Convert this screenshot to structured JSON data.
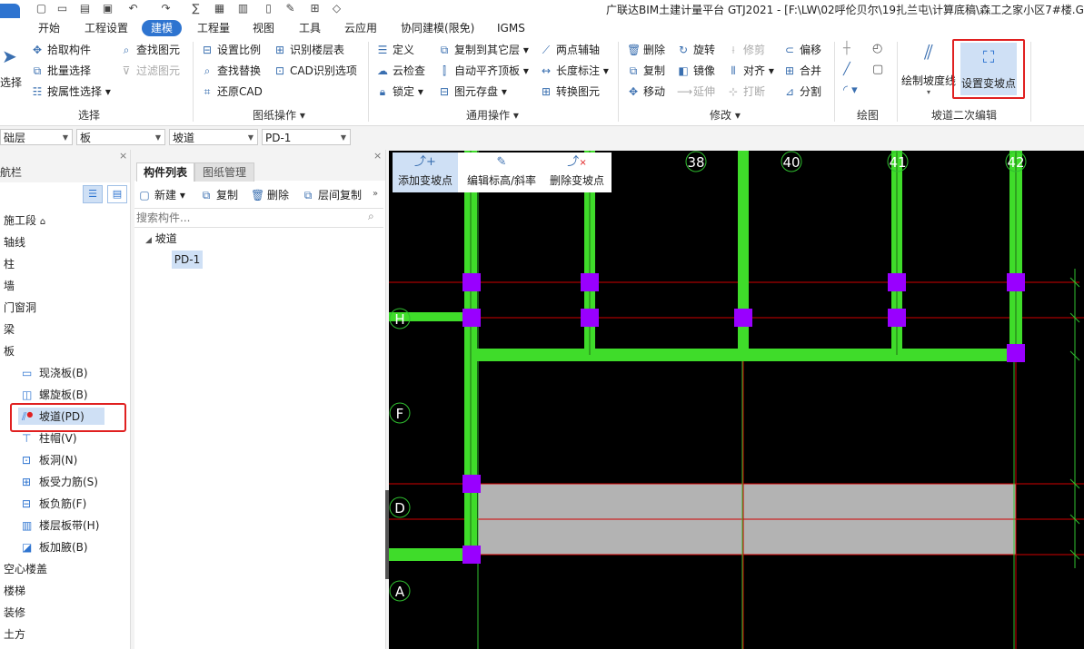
{
  "window": {
    "title": "广联达BIM土建计量平台 GTJ2021 - [F:\\LW\\02呼伦贝尔\\19扎兰屯\\计算底稿\\森工之家小区7#楼.G"
  },
  "menu": [
    "开始",
    "工程设置",
    "建模",
    "工程量",
    "视图",
    "工具",
    "云应用",
    "协同建模(限免)",
    "IGMS"
  ],
  "ribbon": {
    "select_big": "选择",
    "select_items": [
      "拾取构件",
      "批量选择",
      "按属性选择"
    ],
    "find_items": [
      "查找图元",
      "过滤图元"
    ],
    "select_group": "选择",
    "drawing_items": [
      "设置比例",
      "识别楼层表",
      "查找替换",
      "CAD识别选项",
      "还原CAD"
    ],
    "drawing_group": "图纸操作",
    "general_items": [
      "定义",
      "复制到其它层",
      "两点辅轴",
      "云检查",
      "自动平齐顶板",
      "长度标注",
      "锁定",
      "图元存盘",
      "转换图元"
    ],
    "general_group": "通用操作",
    "modify_items": [
      "删除",
      "旋转",
      "修剪",
      "偏移",
      "复制",
      "镜像",
      "对齐",
      "合并",
      "移动",
      "延伸",
      "打断",
      "分割"
    ],
    "modify_group": "修改",
    "draw_group": "绘图",
    "ramp_btn_1": "绘制坡度线",
    "ramp_btn_2": "设置变坡点",
    "ramp_group": "坡道二次编辑"
  },
  "combos": [
    "础层",
    "板",
    "坡道",
    "PD-1"
  ],
  "nav": {
    "title": "航栏",
    "items_top": [
      "施工段",
      "轴线",
      "柱",
      "墙",
      "门窗洞",
      "梁",
      "板"
    ],
    "board_sub": [
      "现浇板(B)",
      "螺旋板(B)",
      "坡道(PD)",
      "柱帽(V)",
      "板洞(N)",
      "板受力筋(S)",
      "板负筋(F)",
      "楼层板带(H)",
      "板加腋(B)"
    ],
    "items_bottom": [
      "空心楼盖",
      "楼梯",
      "装修",
      "土方"
    ]
  },
  "complist": {
    "tabs": [
      "构件列表",
      "图纸管理"
    ],
    "toolbar": [
      "新建",
      "复制",
      "删除",
      "层间复制"
    ],
    "search_placeholder": "搜索构件...",
    "tree_root": "坡道",
    "tree_child": "PD-1"
  },
  "canvas": {
    "commands": [
      "添加变坡点",
      "编辑标高/斜率",
      "删除变坡点"
    ],
    "axis_numbers": [
      "38",
      "40",
      "41",
      "42"
    ],
    "axis_letters": [
      "H",
      "F",
      "D",
      "A"
    ],
    "colors": {
      "beam": "#3fdc2a",
      "node": "#9900ff",
      "grid": "#d00000",
      "slab": "#b3b3b3",
      "axis": "#2fbf2f"
    }
  }
}
